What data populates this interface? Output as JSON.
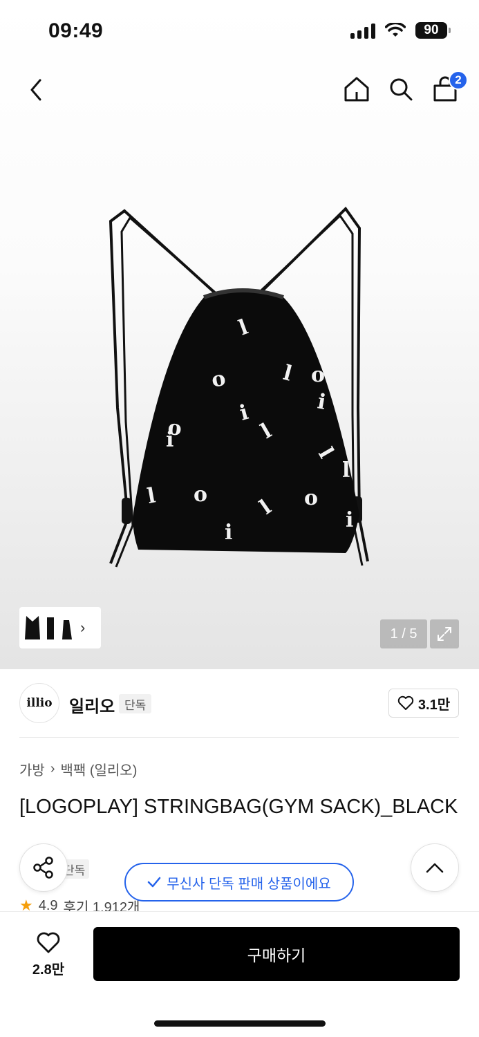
{
  "status_bar": {
    "time": "09:49",
    "battery": "90"
  },
  "nav": {
    "cart_count": "2"
  },
  "gallery": {
    "page_indicator": "1 / 5",
    "bag_letters": [
      "l",
      "o",
      "l",
      "o",
      "o",
      "i",
      "i",
      "i",
      "l",
      "l",
      "l",
      "o",
      "l",
      "o",
      "i",
      "i",
      "l"
    ]
  },
  "brand": {
    "logo_text": "illio",
    "name": "일리오",
    "badge": "단독",
    "like_count": "3.1만"
  },
  "breadcrumb": {
    "category": "가방",
    "subcategory": "백팩 (일리오)"
  },
  "product": {
    "title": "[LOGOPLAY] STRINGBAG(GYM SACK)_BLACK",
    "exclusive_tag": "단독",
    "rating": "4.9",
    "reviews": "후기 1,912개"
  },
  "toast": {
    "message": "무신사 단독 판매 상품이에요"
  },
  "bottom_bar": {
    "wish_count": "2.8만",
    "buy_label": "구매하기"
  },
  "colors": {
    "accent_blue": "#2563eb",
    "buy_button": "#000000",
    "star": "#f59e0b"
  }
}
